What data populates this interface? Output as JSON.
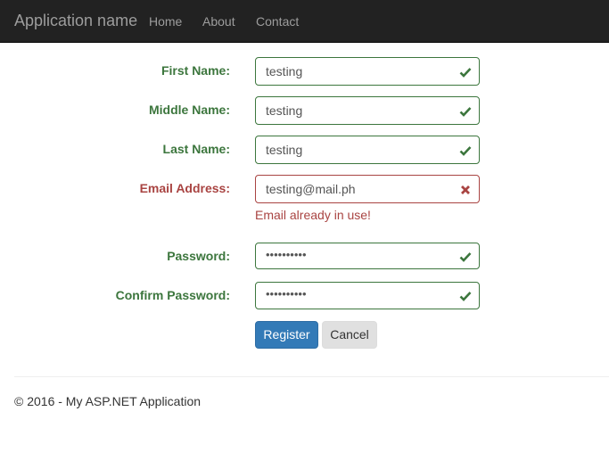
{
  "navbar": {
    "brand": "Application name",
    "links": [
      "Home",
      "About",
      "Contact"
    ]
  },
  "form": {
    "fields": [
      {
        "label": "First Name:",
        "value": "testing",
        "state": "valid",
        "icon": "checkmark-icon"
      },
      {
        "label": "Middle Name:",
        "value": "testing",
        "state": "valid",
        "icon": "checkmark-icon"
      },
      {
        "label": "Last Name:",
        "value": "testing",
        "state": "valid",
        "icon": "checkmark-icon"
      },
      {
        "label": "Email Address:",
        "value": "testing@mail.ph",
        "state": "error",
        "icon": "x-icon",
        "error": "Email already in use!"
      },
      {
        "label": "Password:",
        "value": "••••••••••",
        "state": "valid",
        "icon": "checkmark-icon"
      },
      {
        "label": "Confirm Password:",
        "value": "••••••••••",
        "state": "valid",
        "icon": "checkmark-icon"
      }
    ],
    "register_label": "Register",
    "cancel_label": "Cancel"
  },
  "footer": {
    "text": "© 2016 - My ASP.NET Application"
  },
  "colors": {
    "navbar_bg": "#222222",
    "success": "#3c763d",
    "error": "#a94442",
    "primary": "#337ab7"
  }
}
